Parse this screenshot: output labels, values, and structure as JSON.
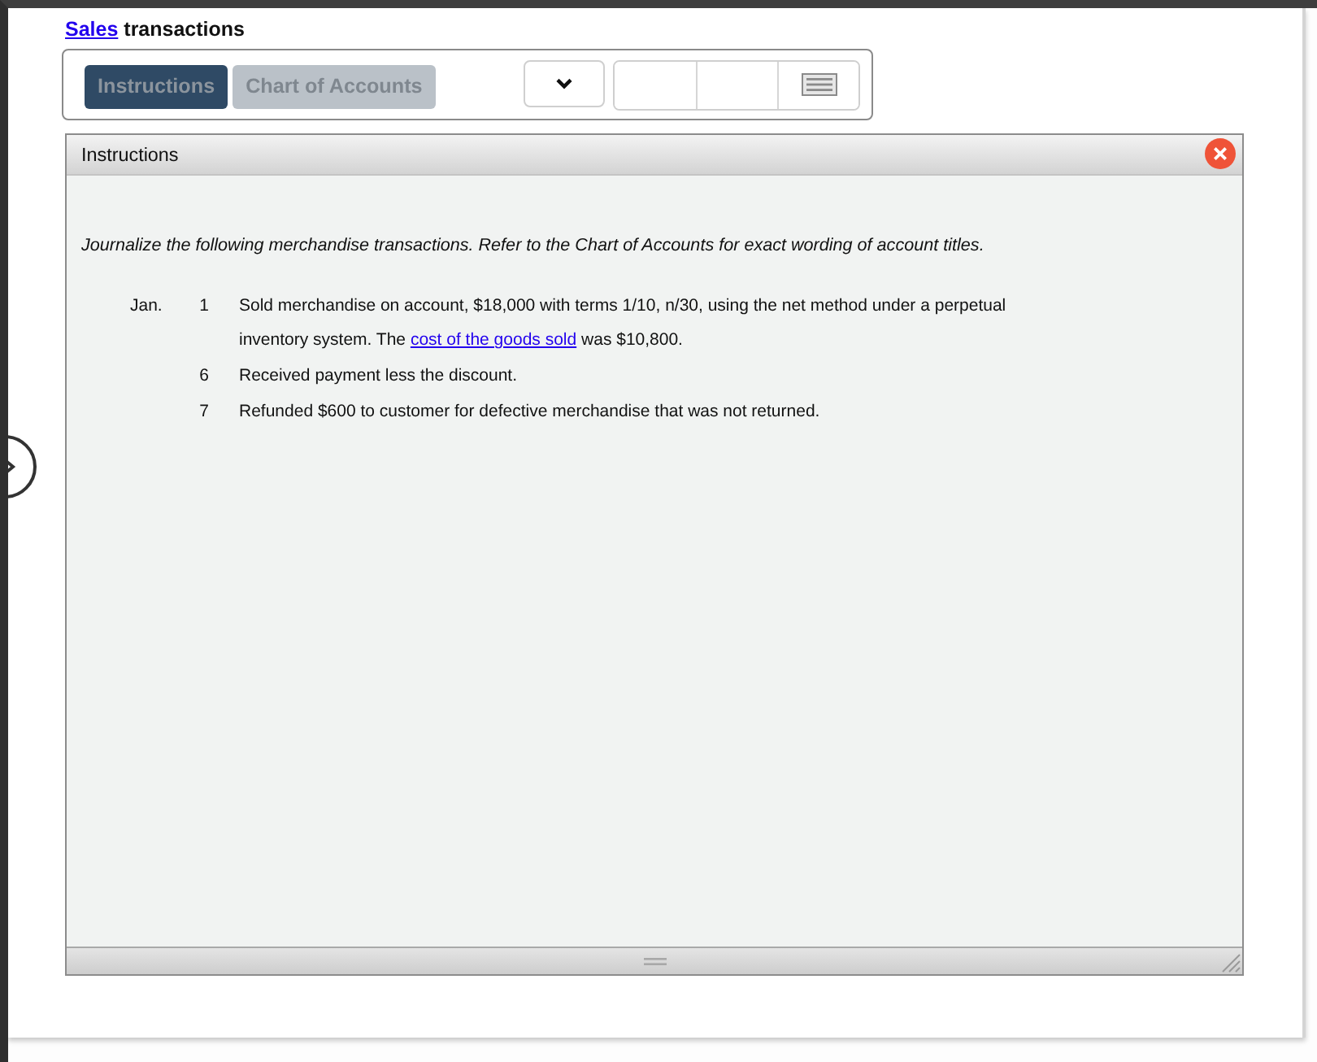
{
  "title": [
    {
      "kind": "link",
      "text": "Sales"
    },
    {
      "kind": "text",
      "text": "transactions"
    }
  ],
  "tabs": [
    {
      "label": "Instructions",
      "selected": true
    },
    {
      "label": "Chart of Accounts",
      "selected": false
    }
  ],
  "panel": {
    "title": "Instructions",
    "intro": "Journalize the following merchandise transactions. Refer to the Chart of Accounts for exact wording of account titles.",
    "entries": [
      {
        "month": "Jan.",
        "day": "1",
        "parts": [
          {
            "kind": "text",
            "text": "Sold merchandise on account, $18,000 with terms 1/10, n/30, using the net method under a perpetual inventory system. The"
          },
          {
            "kind": "link",
            "text": "cost of the goods sold"
          },
          {
            "kind": "text",
            "text": "was $10,800."
          }
        ]
      },
      {
        "day": "6",
        "parts": [
          {
            "kind": "text",
            "text": "Received payment less the discount."
          }
        ]
      },
      {
        "day": "7",
        "parts": [
          {
            "kind": "text",
            "text": "Refunded $600 to customer for defective merchandise that was not returned."
          }
        ]
      }
    ]
  }
}
